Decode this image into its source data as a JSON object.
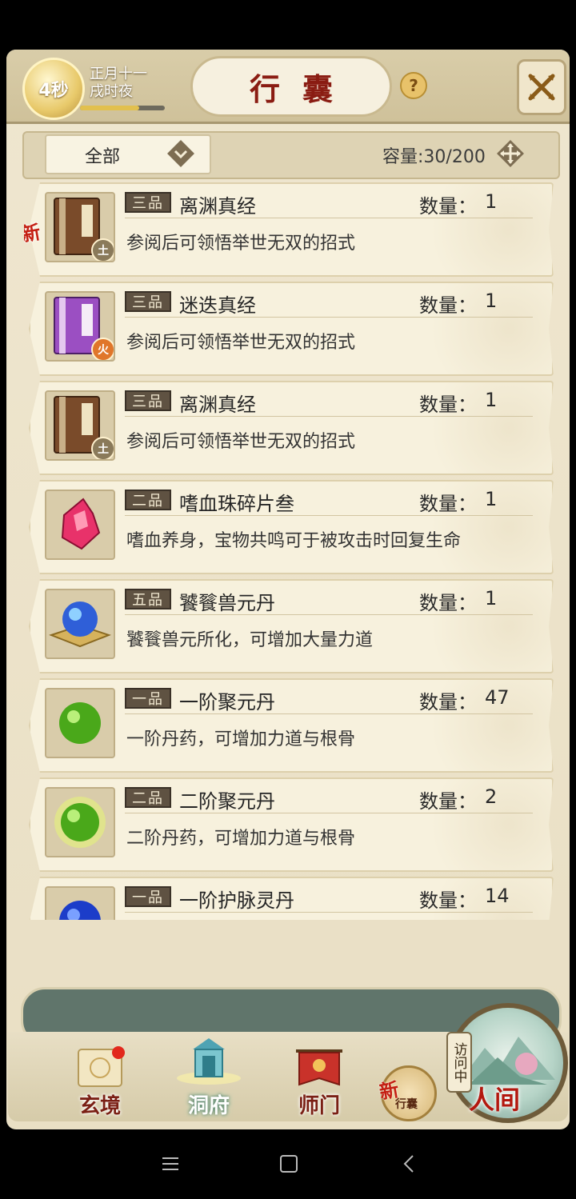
{
  "header": {
    "timer": "4秒",
    "date_line1": "正月十一",
    "date_line2": "戌时夜",
    "time_progress": 0.7,
    "title": "行囊",
    "help": "?"
  },
  "filter": {
    "selected": "全部",
    "capacity": "容量:30/200"
  },
  "qty_label": "数量：",
  "items": [
    {
      "grade": "三品",
      "name": "离渊真经",
      "qty": "1",
      "desc": "参阅后可领悟举世无双的招式",
      "icon": "book-brown-icon",
      "element": "土",
      "new": "新"
    },
    {
      "grade": "三品",
      "name": "迷迭真经",
      "qty": "1",
      "desc": "参阅后可领悟举世无双的招式",
      "icon": "book-purple-icon",
      "element": "火",
      "new": ""
    },
    {
      "grade": "三品",
      "name": "离渊真经",
      "qty": "1",
      "desc": "参阅后可领悟举世无双的招式",
      "icon": "book-brown-icon",
      "element": "土",
      "new": ""
    },
    {
      "grade": "二品",
      "name": "嗜血珠碎片叁",
      "qty": "1",
      "desc": "嗜血养身，宝物共鸣可于被攻击时回复生命",
      "icon": "blood-shard-icon",
      "element": "",
      "new": ""
    },
    {
      "grade": "五品",
      "name": "饕餮兽元丹",
      "qty": "1",
      "desc": "饕餮兽元所化，可增加大量力道",
      "icon": "blue-orb-icon",
      "element": "",
      "new": ""
    },
    {
      "grade": "一品",
      "name": "一阶聚元丹",
      "qty": "47",
      "desc": "一阶丹药，可增加力道与根骨",
      "icon": "green-pill-icon",
      "element": "",
      "new": ""
    },
    {
      "grade": "二品",
      "name": "二阶聚元丹",
      "qty": "2",
      "desc": "二阶丹药，可增加力道与根骨",
      "icon": "green-glow-pill-icon",
      "element": "",
      "new": ""
    },
    {
      "grade": "一品",
      "name": "一阶护脉灵丹",
      "qty": "14",
      "desc": "",
      "icon": "blue-pill-icon",
      "element": "",
      "new": ""
    }
  ],
  "nav": {
    "items": [
      "玄境",
      "洞府",
      "师门"
    ],
    "bag_new": "新",
    "bag_label": "行囊",
    "visit_tag": "访问中",
    "portal_label": "人间"
  },
  "colors": {
    "grade_bg": "#5f5242",
    "title_red": "#8a1c12",
    "nav_green": "#60756b"
  }
}
